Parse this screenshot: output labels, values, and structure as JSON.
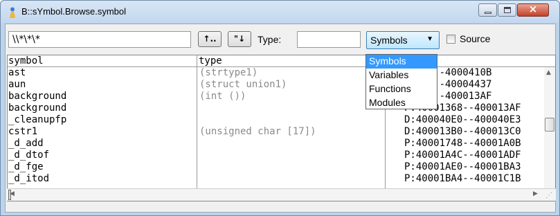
{
  "window": {
    "title": "B::sYmbol.Browse.symbol"
  },
  "toolbar": {
    "search_value": "\\\\*\\*\\*",
    "up_button": "↑..",
    "down_button": "\"↓",
    "type_label": "Type:",
    "type_value": "",
    "combo_value": "Symbols",
    "source_label": "Source",
    "source_checked": false
  },
  "dropdown": {
    "items": [
      "Symbols",
      "Variables",
      "Functions",
      "Modules"
    ],
    "selected": "Symbols"
  },
  "table": {
    "headers": {
      "symbol": "symbol",
      "type": "type"
    },
    "rows": [
      {
        "symbol": "ast",
        "type": "(strtype1)",
        "address": "040F8--4000410B"
      },
      {
        "symbol": "aun",
        "type": "(struct union1)",
        "address": "04420--40004437"
      },
      {
        "symbol": "background",
        "type": "(int ())",
        "address": "01368--400013AF"
      },
      {
        "symbol": "background",
        "type": "",
        "address": "P:40001368--400013AF"
      },
      {
        "symbol": "_cleanupfp",
        "type": "",
        "address": "D:400040E0--400040E3"
      },
      {
        "symbol": "cstr1",
        "type": "(unsigned char [17])",
        "address": "D:400013B0--400013C0"
      },
      {
        "symbol": "_d_add",
        "type": "",
        "address": "P:40001748--40001A0B"
      },
      {
        "symbol": "_d_dtof",
        "type": "",
        "address": "P:40001A4C--40001ADF"
      },
      {
        "symbol": "_d_fge",
        "type": "",
        "address": "P:40001AE0--40001BA3"
      },
      {
        "symbol": "_d_itod",
        "type": "",
        "address": "P:40001BA4--40001C1B"
      }
    ]
  }
}
